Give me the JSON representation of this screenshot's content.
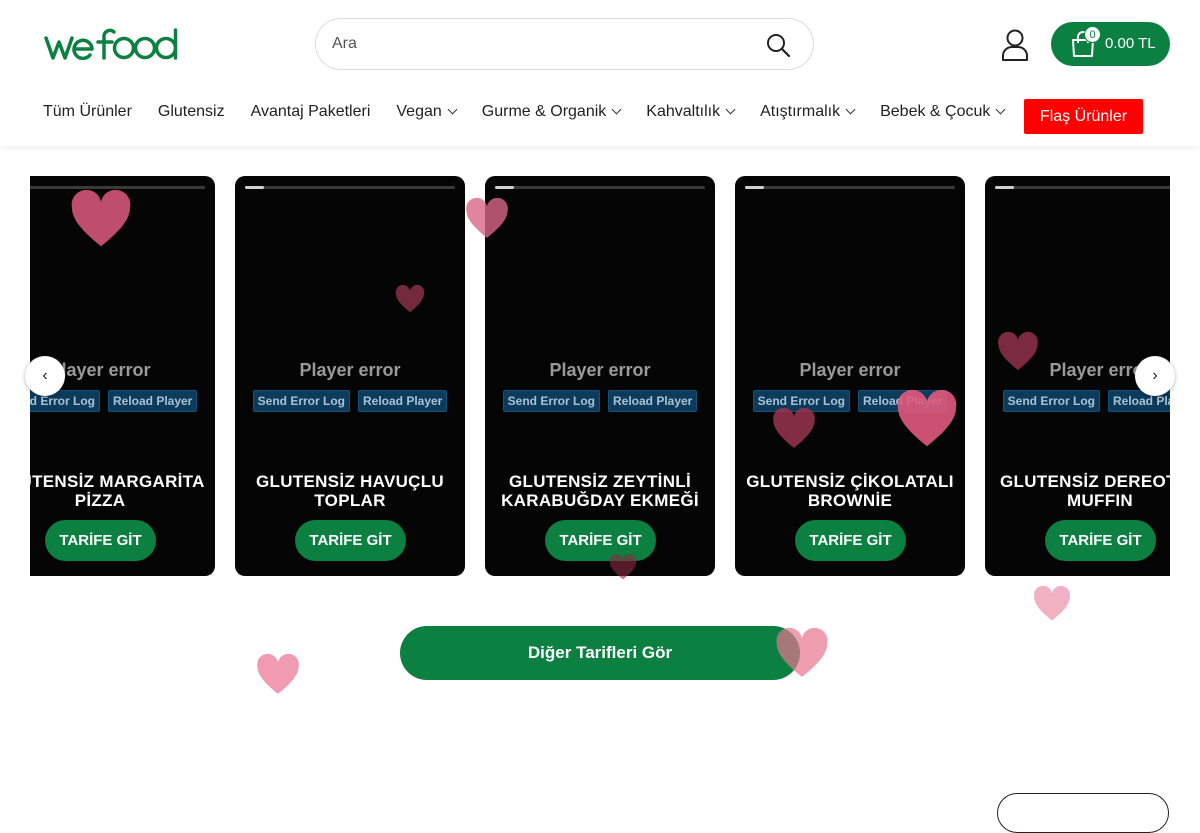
{
  "header": {
    "logo_text": "wefood",
    "search": {
      "placeholder": "Ara"
    },
    "cart": {
      "count": "0",
      "total": "0.00 TL"
    }
  },
  "nav": {
    "items": [
      {
        "label": "Tüm Ürünler",
        "has_dropdown": false
      },
      {
        "label": "Glutensiz",
        "has_dropdown": false
      },
      {
        "label": "Avantaj Paketleri",
        "has_dropdown": false
      },
      {
        "label": "Vegan",
        "has_dropdown": true
      },
      {
        "label": "Gurme & Organik",
        "has_dropdown": true
      },
      {
        "label": "Kahvaltılık",
        "has_dropdown": true
      },
      {
        "label": "Atıştırmalık",
        "has_dropdown": true
      },
      {
        "label": "Bebek & Çocuk",
        "has_dropdown": true
      }
    ],
    "flash_label": "Flaş Ürünler"
  },
  "recipes": {
    "player_error": "Player error",
    "send_error_log": "Send Error Log",
    "reload_player": "Reload Player",
    "cta_label": "TARİFE GİT",
    "cards": [
      {
        "title": "GLUTENSİZ MARGARİTA PİZZA",
        "progress": 0.1
      },
      {
        "title": "GLUTENSİZ HAVUÇLU TOPLAR",
        "progress": 0.09
      },
      {
        "title": "GLUTENSİZ ZEYTİNLİ KARABUĞDAY EKMEĞİ",
        "progress": 0.09
      },
      {
        "title": "GLUTENSİZ ÇİKOLATALI BROWNİE",
        "progress": 0.09
      },
      {
        "title": "GLUTENSİZ DEREOTLU MUFFIN",
        "progress": 0.09
      }
    ],
    "more_label": "Diğer Tarifleri Gör"
  },
  "colors": {
    "brand_green": "#0b8040",
    "flash_red": "#ff0000",
    "heart_pink": "#e05a7e"
  },
  "icons": [
    "search-icon",
    "user-icon",
    "shopping-bag-icon",
    "chevron-down-icon",
    "chevron-left-icon",
    "chevron-right-icon",
    "heart-icon"
  ]
}
